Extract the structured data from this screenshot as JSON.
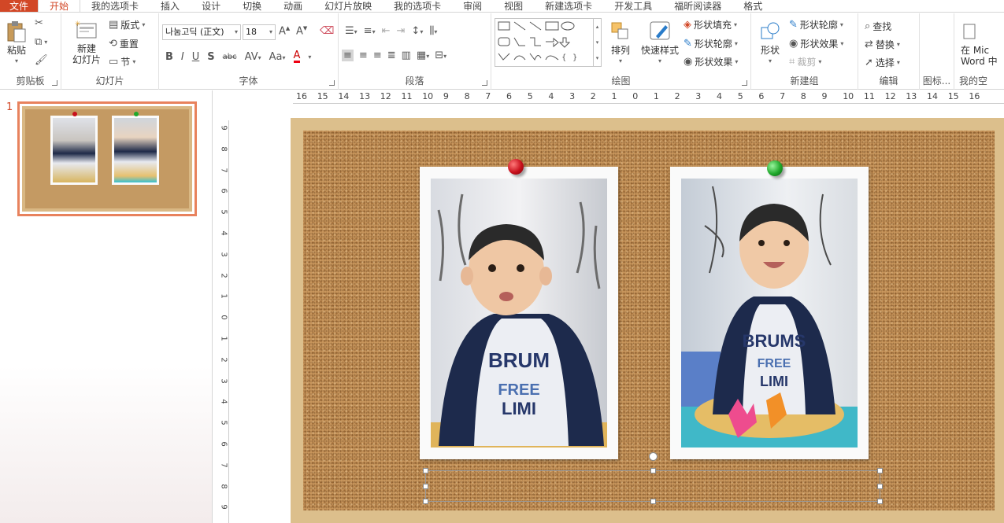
{
  "tabs": [
    "文件",
    "开始",
    "我的选项卡",
    "插入",
    "设计",
    "切换",
    "动画",
    "幻灯片放映",
    "我的选项卡",
    "审阅",
    "视图",
    "新建选项卡",
    "开发工具",
    "福昕阅读器",
    "格式"
  ],
  "ribbon": {
    "clipboard": {
      "label": "剪贴板",
      "paste": "粘贴"
    },
    "slides": {
      "label": "幻灯片",
      "new_slide": "新建\n幻灯片",
      "layout": "版式",
      "reset": "重置",
      "section": "节"
    },
    "font": {
      "label": "字体",
      "font_name": "나눔고딕 (正文)",
      "font_size": "18"
    },
    "paragraph": {
      "label": "段落"
    },
    "drawing": {
      "label": "绘图",
      "arrange": "排列",
      "quick_styles": "快速样式",
      "fill": "形状填充",
      "outline": "形状轮廓",
      "effect": "形状效果"
    },
    "new_group": {
      "label": "新建组",
      "shape": "形状",
      "outline": "形状轮廓",
      "effect": "形状效果",
      "crop": "裁剪"
    },
    "editing": {
      "label": "编辑",
      "find": "查找",
      "replace": "替换",
      "select": "选择"
    },
    "icons": {
      "label": "图标..."
    },
    "my_group": {
      "label": "我的空",
      "word_line1": "在 Mic",
      "word_line2": "Word 中"
    }
  },
  "thumbnail": {
    "number": "1"
  },
  "hruler_labels": [
    "16",
    "15",
    "14",
    "13",
    "12",
    "11",
    "10",
    "9",
    "8",
    "7",
    "6",
    "5",
    "4",
    "3",
    "2",
    "1",
    "0",
    "1",
    "2",
    "3",
    "4",
    "5",
    "6",
    "7",
    "8",
    "9",
    "10",
    "11",
    "12",
    "13",
    "14",
    "15",
    "16"
  ],
  "vruler_labels": [
    "9",
    "8",
    "7",
    "6",
    "5",
    "4",
    "3",
    "2",
    "1",
    "0",
    "1",
    "2",
    "3",
    "4",
    "5",
    "6",
    "7",
    "8",
    "9"
  ],
  "colors": {
    "accent": "#d24726",
    "pin_left": "#c8101c",
    "pin_right": "#1fa82a"
  }
}
